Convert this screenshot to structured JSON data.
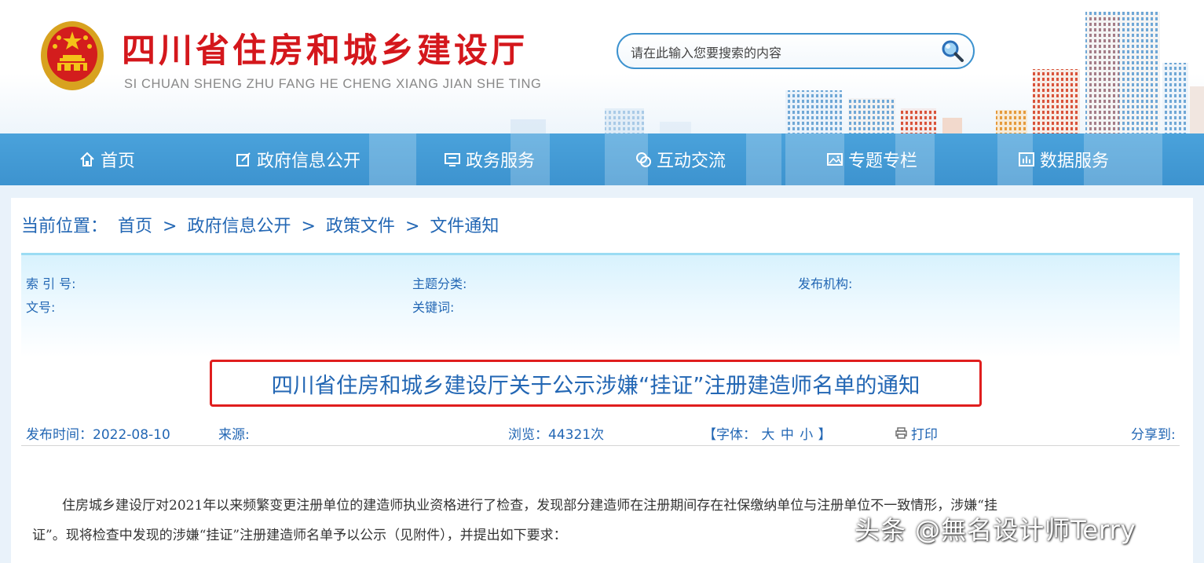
{
  "header": {
    "title": "四川省住房和城乡建设厅",
    "subtitle": "SI CHUAN SHENG ZHU FANG HE CHENG XIANG JIAN SHE TING",
    "emblem_icon": "national-emblem-icon",
    "search": {
      "placeholder": "请在此输入您要搜索的内容",
      "button_icon": "magnifier-icon"
    }
  },
  "nav": {
    "items": [
      {
        "label": "首页",
        "icon": "home-icon"
      },
      {
        "label": "政府信息公开",
        "icon": "edit-icon"
      },
      {
        "label": "政务服务",
        "icon": "monitor-icon"
      },
      {
        "label": "互动交流",
        "icon": "chat-icon"
      },
      {
        "label": "专题专栏",
        "icon": "picture-icon"
      },
      {
        "label": "数据服务",
        "icon": "chart-icon"
      }
    ]
  },
  "breadcrumb": {
    "prefix": "当前位置：",
    "items": [
      "首页",
      "政府信息公开",
      "政策文件",
      "文件通知"
    ],
    "separator": ">"
  },
  "meta": {
    "index_no_label": "索 引 号:",
    "topic_label": "主题分类:",
    "publisher_label": "发布机构:",
    "doc_no_label": "文号:",
    "keywords_label": "关键词:"
  },
  "article": {
    "title": "四川省住房和城乡建设厅关于公示涉嫌“挂证”注册建造师名单的通知",
    "publish_time": "发布时间：2022-08-10",
    "source": "来源:",
    "views": "浏览：44321次",
    "font_label": "【字体：",
    "font_sizes": [
      "大",
      "中",
      "小"
    ],
    "font_close": "】",
    "print_label": "打印",
    "share_label": "分享到:",
    "paragraph_line1": "住房城乡建设厅对2021年以来频繁变更注册单位的建造师执业资格进行了检查，发现部分建造师在注册期间存在社保缴纳单位与注册单位不一致情形，涉嫌“挂",
    "paragraph_line2": "证”。现将检查中发现的涉嫌“挂证”注册建造师名单予以公示（见附件），并提出如下要求："
  },
  "watermark": "头条 @無名设计师Terry",
  "colors": {
    "title_red": "#d4171c",
    "nav_blue": "#3d93cf",
    "link_blue": "#2367b4",
    "highlight_red": "#e01e1e"
  }
}
